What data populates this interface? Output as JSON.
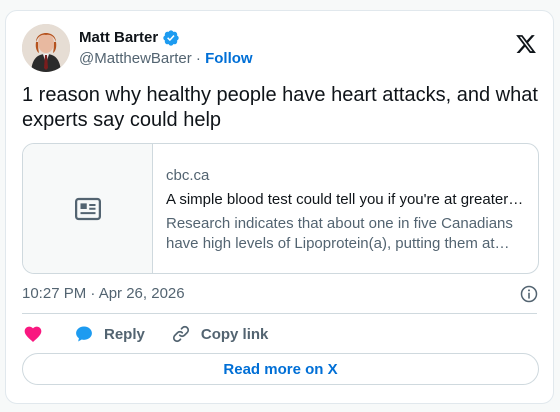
{
  "author": {
    "name": "Matt Barter",
    "handle": "@MatthewBarter",
    "separator": " · ",
    "follow_label": "Follow",
    "verified": true
  },
  "tweet": {
    "text": "1 reason why healthy people have heart attacks, and what experts say could help"
  },
  "link_card": {
    "domain": "cbc.ca",
    "title": "A simple blood test could tell you if you're at greater risk of heart attack or stroke",
    "description": "Research indicates that about one in five Canadians have high levels of Lipoprotein(a), putting them at higher risk."
  },
  "meta": {
    "timestamp": "10:27 PM · Apr 26, 2026"
  },
  "actions": {
    "reply_label": "Reply",
    "copy_link_label": "Copy link"
  },
  "footer": {
    "read_more_label": "Read more on X"
  },
  "colors": {
    "brand_blue": "#1d9bf0",
    "link_blue": "#006fd6",
    "heart_pink": "#f91880",
    "muted_text": "#536471"
  },
  "icons": [
    "verified-badge-icon",
    "x-logo-icon",
    "article-icon",
    "info-icon",
    "heart-icon",
    "reply-bubble-icon",
    "link-icon"
  ]
}
